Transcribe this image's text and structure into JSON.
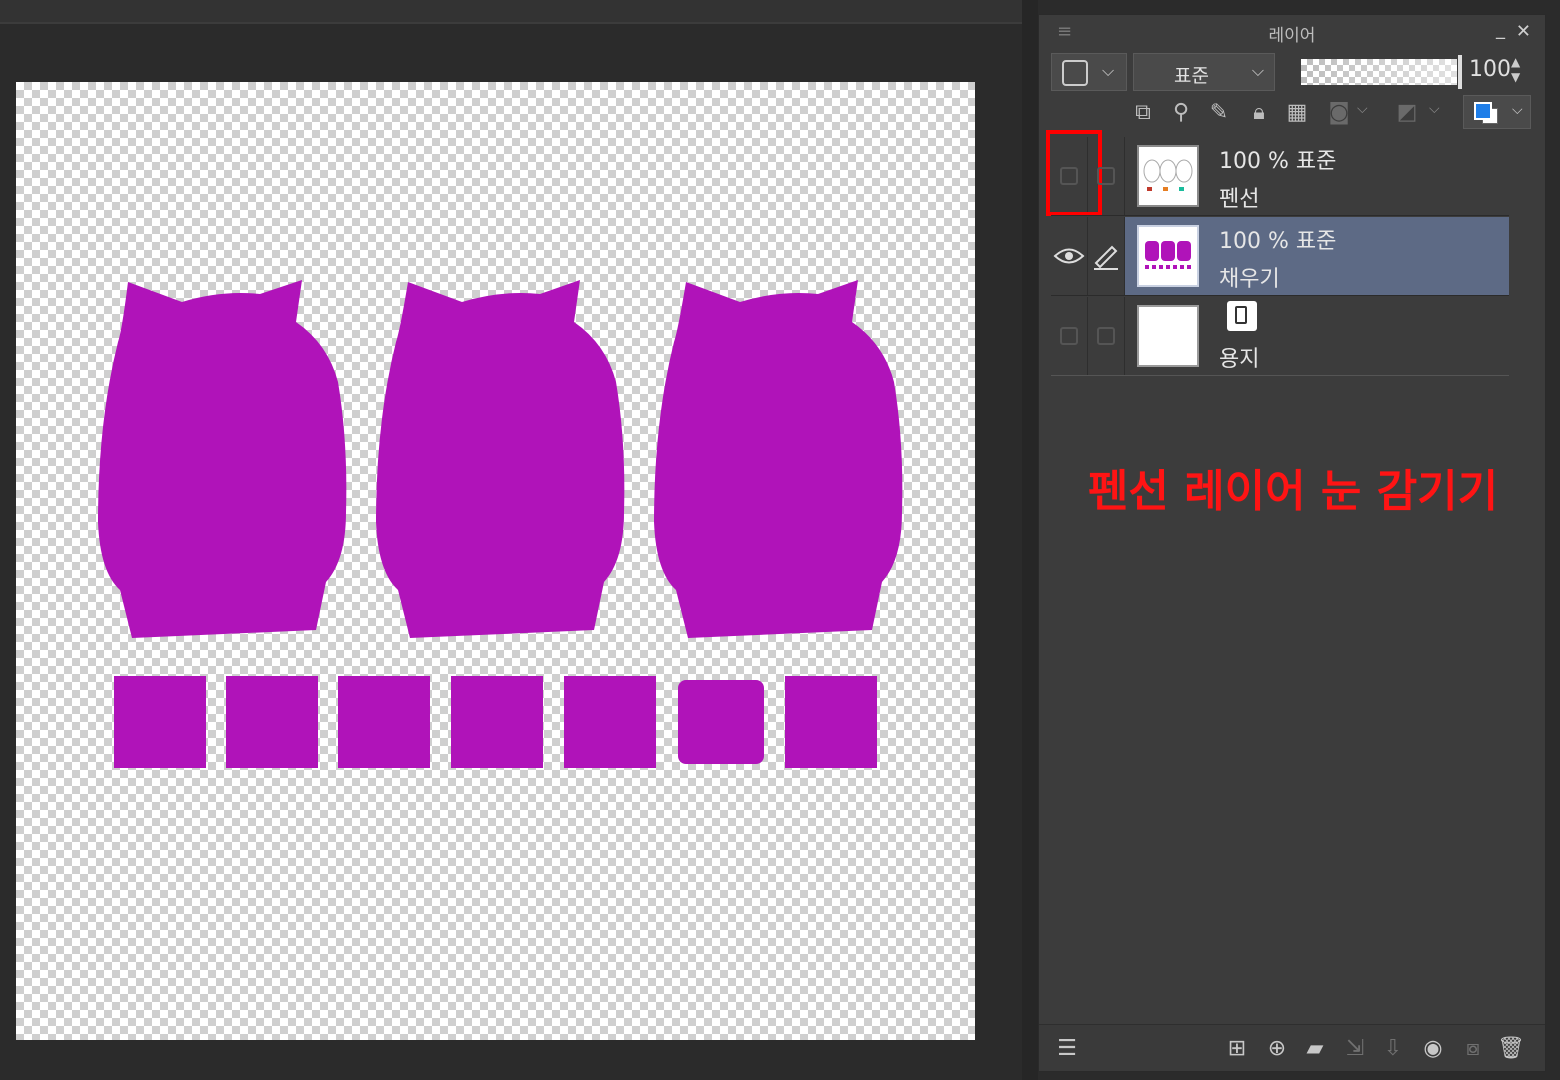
{
  "panel": {
    "title": "레이어",
    "menu_icon": "hamburger-menu-icon",
    "minimize_icon": "minimize-icon",
    "close_icon": "close-icon",
    "blend_mode": "표준",
    "opacity": "100"
  },
  "layers": [
    {
      "percent": "100 % 표준",
      "name": "펜선",
      "visible": false,
      "selected": false
    },
    {
      "percent": "100 % 표준",
      "name": "채우기",
      "visible": true,
      "selected": true
    },
    {
      "percent": "",
      "name": "용지",
      "visible": false,
      "selected": false
    }
  ],
  "annotation": "펜선 레이어 눈 감기기",
  "colors": {
    "fill_purple": "#b013b9",
    "selected_layer": "#5d6a85",
    "highlight_red": "#ff0000"
  }
}
